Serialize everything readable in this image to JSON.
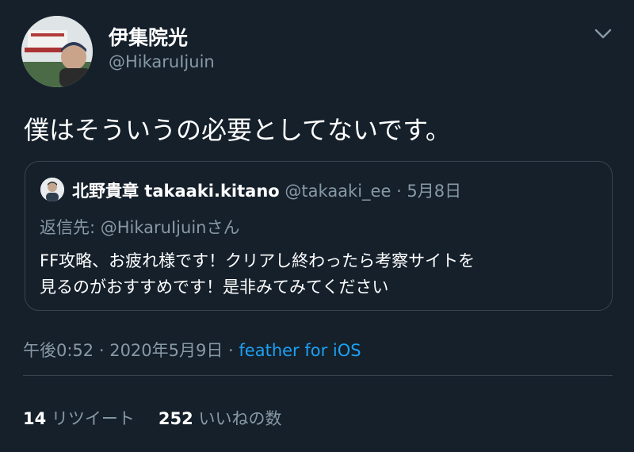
{
  "author": {
    "name": "伊集院光",
    "handle": "@HikaruIjuin",
    "avatar_icon": "profile-photo"
  },
  "header": {
    "more_icon": "chevron-down-icon"
  },
  "tweet": {
    "text": "僕はそういうの必要としてないです。"
  },
  "quote": {
    "name": "北野貴章 takaaki.kitano",
    "handle": "@takaaki_ee",
    "separator": " · ",
    "date": "5月8日",
    "reply_to": "返信先: @HikaruIjuinさん",
    "body_line1": "FF攻略、お疲れ様です！クリアし終わったら考察サイトを",
    "body_line2": "見るのがおすすめです！是非みてみてください"
  },
  "meta": {
    "time": "午後0:52",
    "sep1": " · ",
    "date": "2020年5月9日",
    "sep2": " · ",
    "source": "feather for iOS"
  },
  "stats": {
    "retweets_count": "14",
    "retweets_label": "リツイート",
    "likes_count": "252",
    "likes_label": "いいねの数"
  },
  "colors": {
    "background": "#15202b",
    "secondary_text": "#8899a6",
    "link": "#1da1f2",
    "border": "#38444d"
  }
}
